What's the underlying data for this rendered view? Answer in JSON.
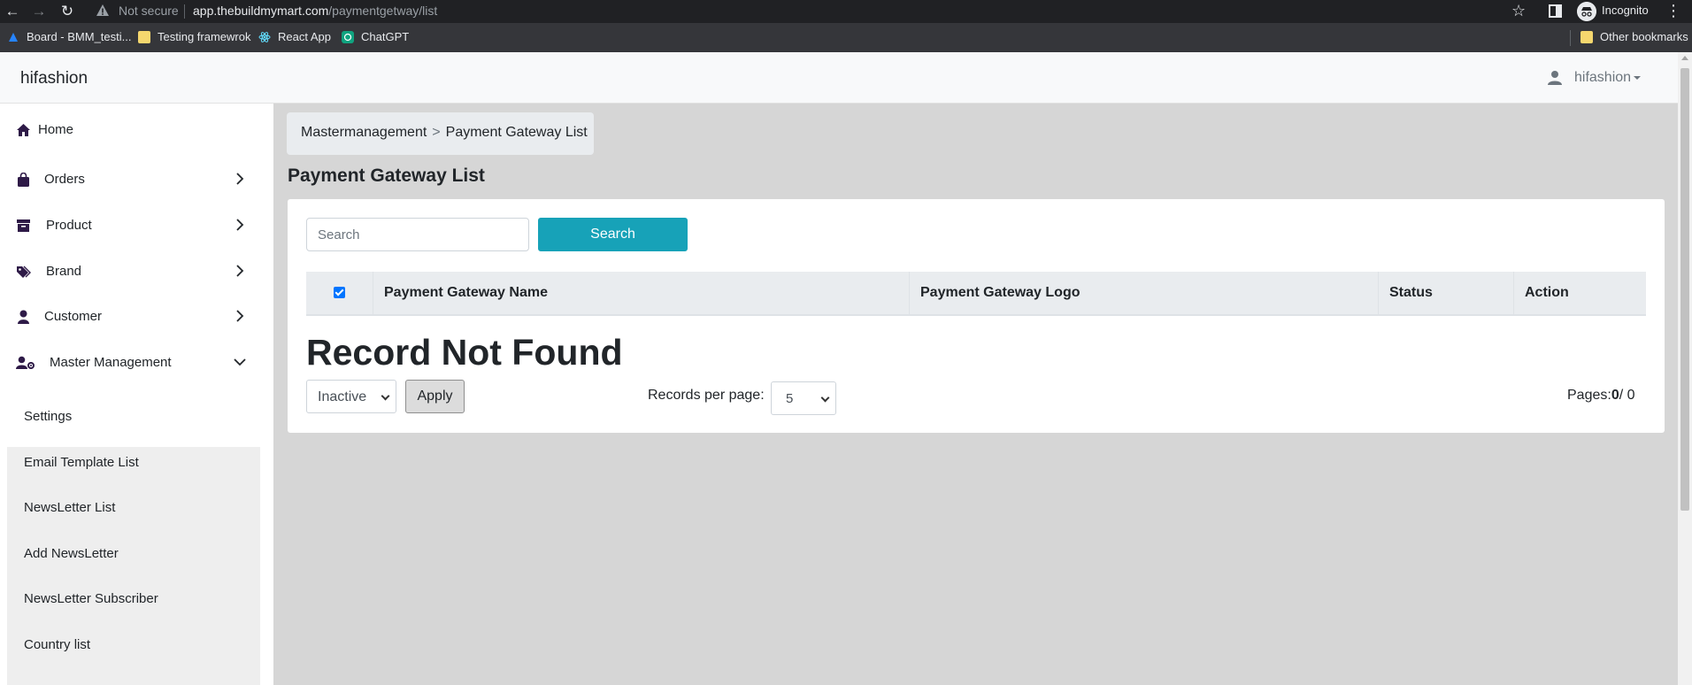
{
  "browser": {
    "security_label": "Not secure",
    "url_host": "app.thebuildmymart.com",
    "url_path": "/paymentgetway/list",
    "profile_label": "Incognito",
    "bookmarks": [
      {
        "label": "Board - BMM_testi...",
        "icon": "trello-icon"
      },
      {
        "label": "Testing framewrok",
        "icon": "folder-icon"
      },
      {
        "label": "React App",
        "icon": "react-icon"
      },
      {
        "label": "ChatGPT",
        "icon": "chatgpt-icon"
      }
    ],
    "other_bookmarks": "Other bookmarks"
  },
  "navbar": {
    "brand": "hifashion",
    "user": "hifashion"
  },
  "sidebar": {
    "items": [
      {
        "label": "Home",
        "icon": "home-icon"
      },
      {
        "label": "Orders",
        "icon": "bag-icon"
      },
      {
        "label": "Product",
        "icon": "archive-icon"
      },
      {
        "label": "Brand",
        "icon": "tags-icon"
      },
      {
        "label": "Customer",
        "icon": "user-icon"
      },
      {
        "label": "Master Management",
        "icon": "user-gear-icon"
      }
    ],
    "submenu": [
      "Settings",
      "Email Template List",
      "NewsLetter List",
      "Add NewsLetter",
      "NewsLetter Subscriber",
      "Country list"
    ]
  },
  "breadcrumb": {
    "parent": "Mastermanagement",
    "separator": ">",
    "current": "Payment Gateway List"
  },
  "main": {
    "title": "Payment Gateway List",
    "search_placeholder": "Search",
    "search_button": "Search",
    "columns": [
      "Payment Gateway Name",
      "Payment Gateway Logo",
      "Status",
      "Action"
    ],
    "empty_message": "Record Not Found",
    "status_select_value": "Inactive",
    "apply_button": "Apply",
    "records_per_page_label": "Records per page:",
    "records_per_page_value": "5",
    "pages_label": "Pages:",
    "pages_current": "0",
    "pages_total": "/ 0"
  },
  "colors": {
    "accent": "#17a2b8",
    "icon": "#2e1a47",
    "content_bg": "#d6d6d6"
  }
}
